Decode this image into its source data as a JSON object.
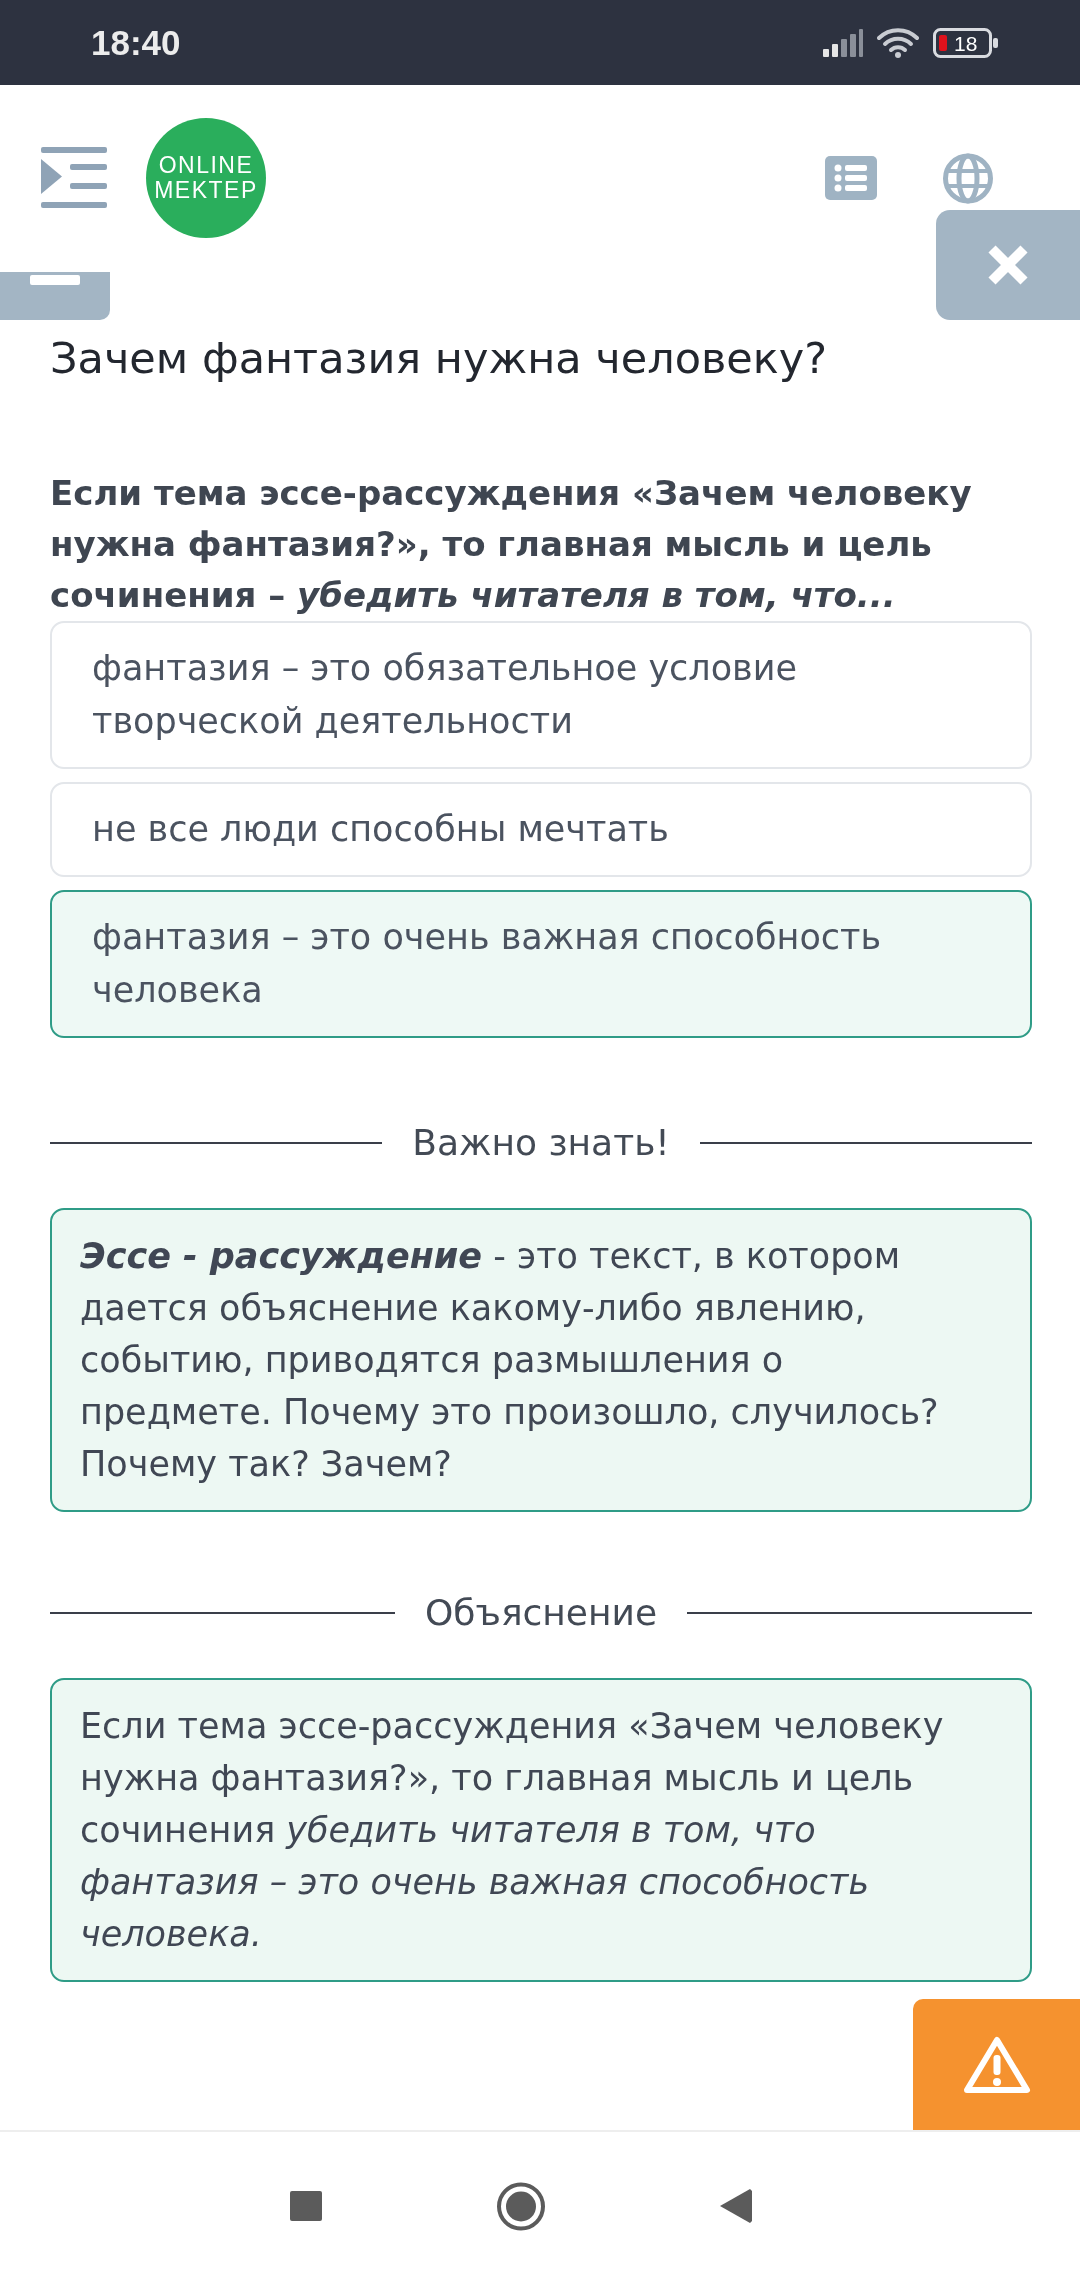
{
  "status_bar": {
    "time": "18:40",
    "battery": "18"
  },
  "header": {
    "logo": {
      "line_1": "ONLINE",
      "line_2": "MEKTEP"
    }
  },
  "title": "Зачем фантазия нужна человеку?",
  "question": "Если тема эссе-рассуждения «Зачем человеку нужна фантазия?», то главная мысль и цель сочинения – *убедить читателя в том, что...*",
  "options": [
    {
      "text": "фантазия – это обязательное условие творческой деятельности",
      "selected": false
    },
    {
      "text": "не все люди способны мечтать",
      "selected": false
    },
    {
      "text": "фантазия – это очень важная способность человека",
      "selected": true
    }
  ],
  "sections": [
    {
      "heading": "Важно знать!",
      "text": "**Эссе - рассуждение** - это текст, в котором дается объяснение какому-либо явлению, событию, приводятся размышления о предмете. Почему это произошло, случилось? Почему так? Зачем?"
    },
    {
      "heading": "Объяснение",
      "text": "Если тема эссе-рассуждения «Зачем человеку нужна фантазия?», то главная мысль и цель сочинения *убедить читателя в том, что фантазия – это очень важная способность человека.*"
    }
  ]
}
